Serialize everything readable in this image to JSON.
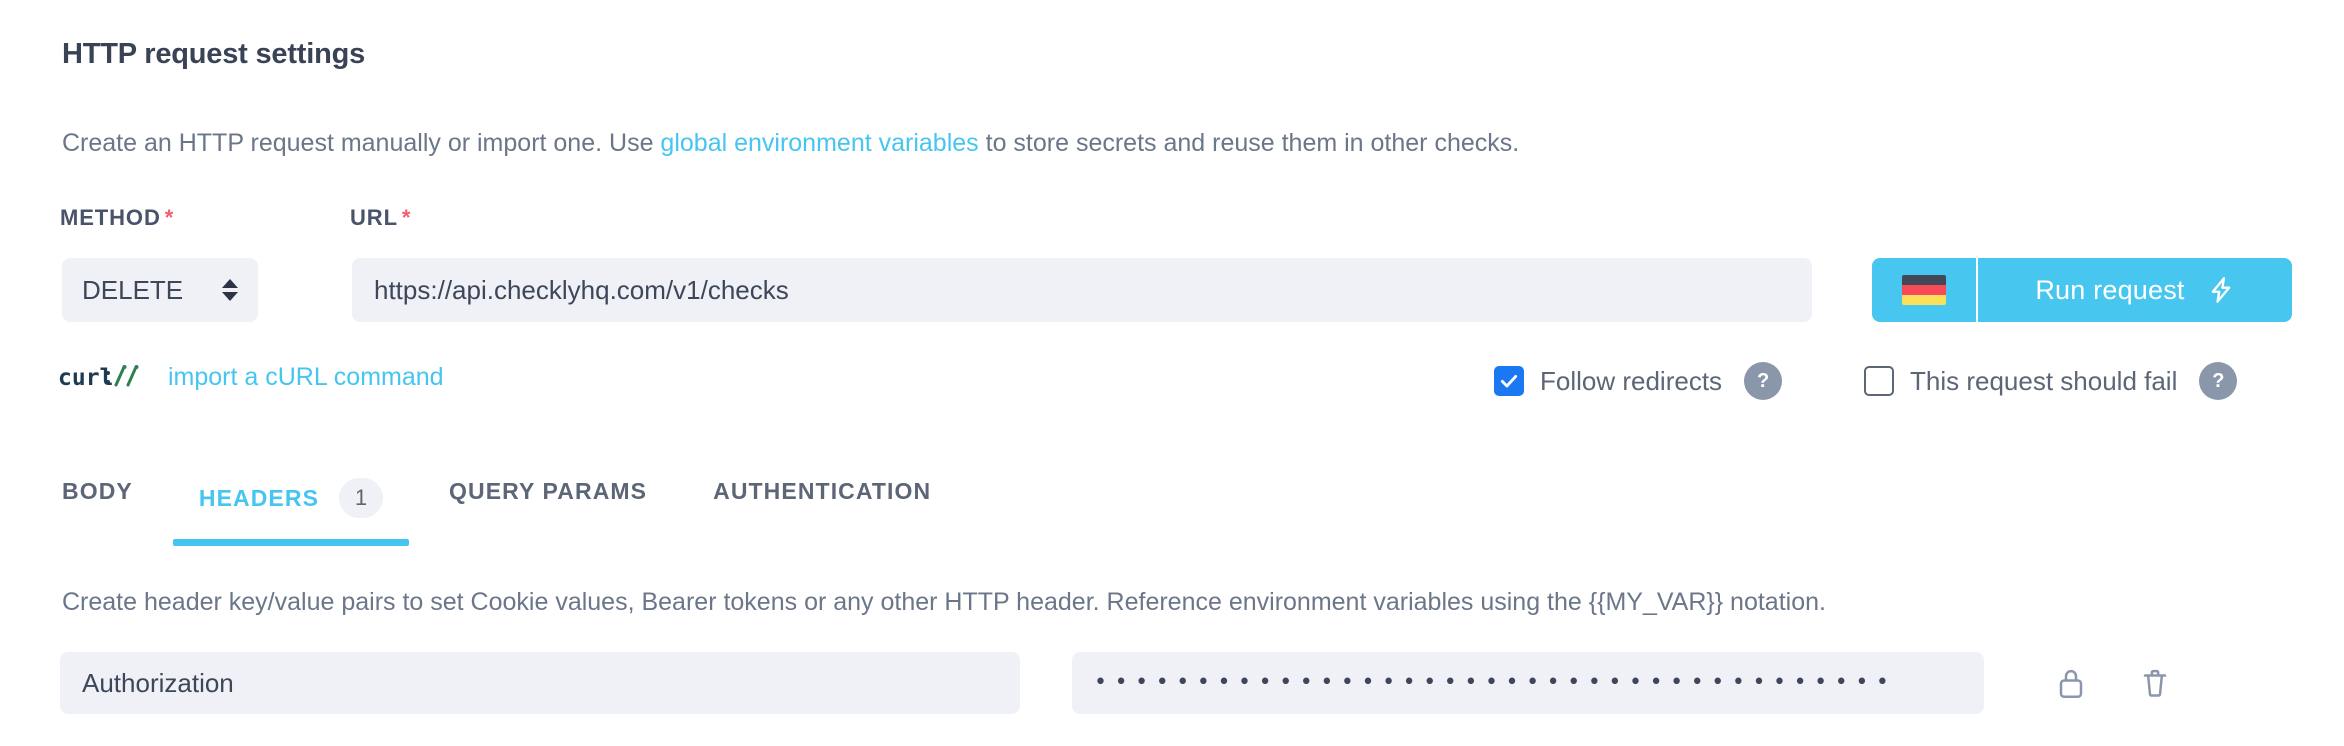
{
  "section": {
    "title": "HTTP request settings",
    "intro_prefix": "Create an HTTP request manually or import one. Use ",
    "intro_link": "global environment variables",
    "intro_suffix": " to store secrets and reuse them in other checks."
  },
  "method": {
    "label": "METHOD",
    "required_mark": "*",
    "value": "DELETE",
    "icon": "updown-arrows-icon"
  },
  "url": {
    "label": "URL",
    "required_mark": "*",
    "value": "https://api.checklyhq.com/v1/checks",
    "placeholder": "https://api.checklyhq.com/v1/checks"
  },
  "run_button": {
    "label": "Run request",
    "flag": "german-flag-icon",
    "bolt": "lightning-bolt-icon",
    "color": "#47c6ef"
  },
  "curl": {
    "logo_text": "curl://",
    "link_text": "import a cURL command",
    "link_color": "#45c5f0"
  },
  "options": [
    {
      "id": "follow-redirects",
      "label": "Follow redirects",
      "checked": true,
      "help": "?",
      "checked_color": "#1a79f2"
    },
    {
      "id": "this-request-should-fail",
      "label": "This request should fail",
      "checked": false,
      "help": "?"
    }
  ],
  "tabs": [
    {
      "label": "BODY",
      "active": false,
      "badge": ""
    },
    {
      "label": "HEADERS",
      "active": true,
      "badge": "1"
    },
    {
      "label": "QUERY PARAMS",
      "active": false,
      "badge": ""
    },
    {
      "label": "AUTHENTICATION",
      "active": false,
      "badge": ""
    }
  ],
  "tab_panel": {
    "description": "Create header key/value pairs to set Cookie values, Bearer tokens or any other HTTP header. Reference environment variables using the {{MY_VAR}} notation.",
    "rows": [
      {
        "key": "Authorization",
        "key_placeholder": "Authorization",
        "value_masked": "•••••••••••••••••••••••••••••••••••••••",
        "lock_icon": "lock-icon",
        "delete_icon": "trash-icon"
      }
    ]
  },
  "colors": {
    "accent": "#45c5f0",
    "input_bg": "#eff1f6",
    "text": "#3d4759",
    "muted": "#6b7689",
    "required": "#f0616e",
    "help_bg": "#8a97ab"
  }
}
